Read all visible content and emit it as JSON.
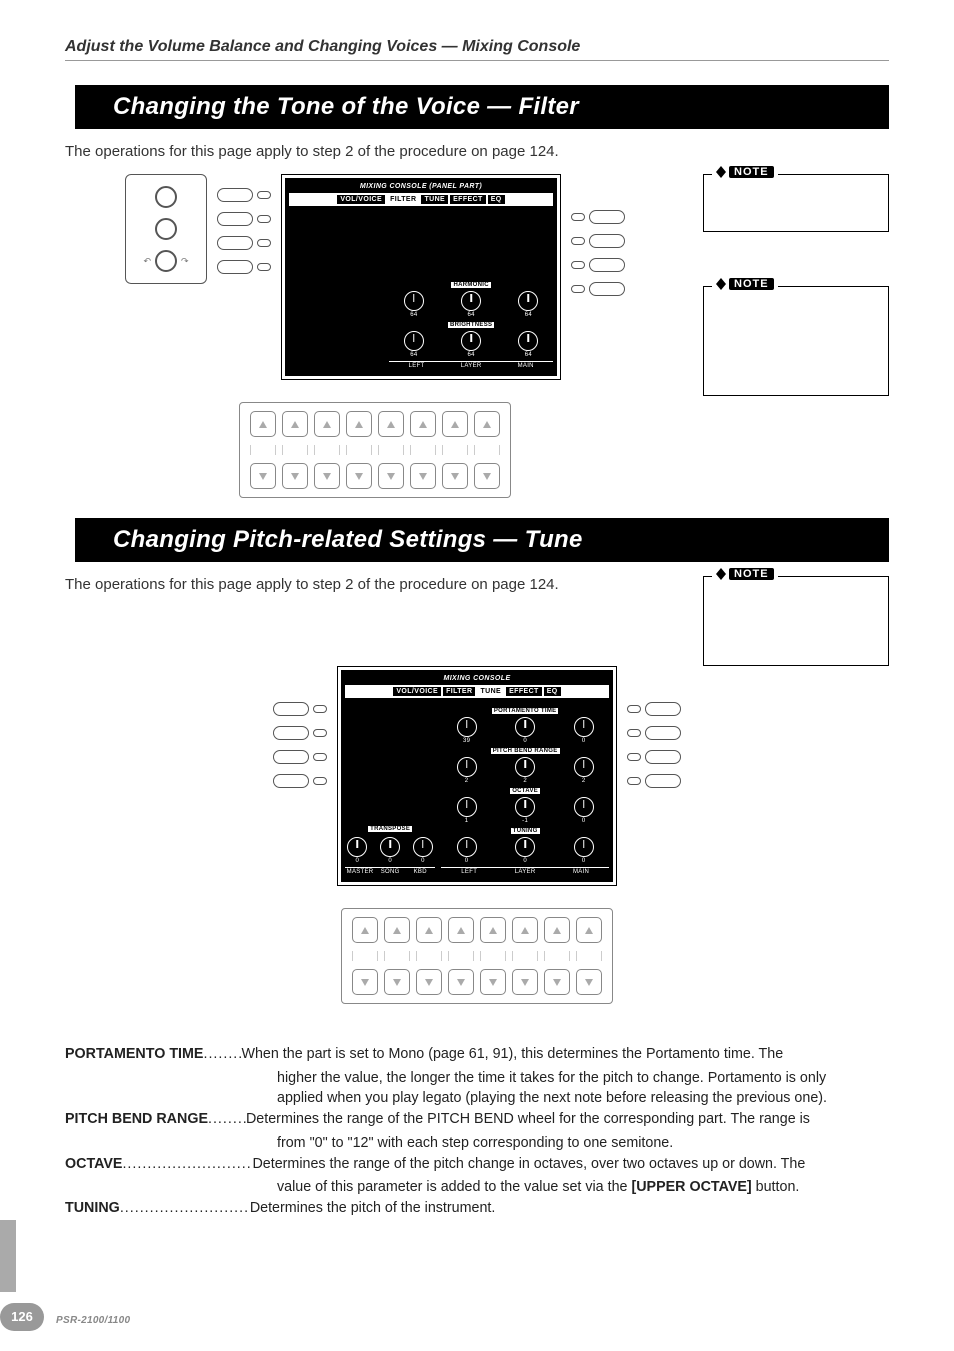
{
  "header": "Adjust the Volume Balance and Changing Voices — Mixing Console",
  "sectionA": {
    "title": "Changing the Tone of the Voice — Filter",
    "intro": "The operations for this page apply to step 2 of the procedure on page 124.",
    "screen": {
      "title": "MIXING CONSOLE (PANEL PART)",
      "tabs": [
        "VOL/VOICE",
        "FILTER",
        "TUNE",
        "EFFECT",
        "EQ"
      ],
      "active_tab": "FILTER",
      "sections": [
        {
          "name": "HARMONIC",
          "cols": [
            {
              "col": "LEFT",
              "value": "64"
            },
            {
              "col": "LAYER",
              "value": "64"
            },
            {
              "col": "MAIN",
              "value": "64"
            }
          ]
        },
        {
          "name": "BRIGHTNESS",
          "cols": [
            {
              "col": "LEFT",
              "value": "64"
            },
            {
              "col": "LAYER",
              "value": "64"
            },
            {
              "col": "MAIN",
              "value": "64"
            }
          ]
        }
      ],
      "col_labels": [
        "LEFT",
        "LAYER",
        "MAIN"
      ]
    },
    "note1_label": "NOTE",
    "note2_label": "NOTE",
    "under_button_count": 8
  },
  "sectionB": {
    "title": "Changing Pitch-related Settings — Tune",
    "intro": "The operations for this page apply to step 2 of the procedure on page 124.",
    "note_label": "NOTE",
    "screen": {
      "title": "MIXING CONSOLE",
      "tabs": [
        "VOL/VOICE",
        "FILTER",
        "TUNE",
        "EFFECT",
        "EQ"
      ],
      "active_tab": "TUNE",
      "right_sections": [
        {
          "name": "PORTAMENTO TIME",
          "vals": [
            "39",
            "0",
            "0"
          ]
        },
        {
          "name": "PITCH BEND RANGE",
          "vals": [
            "2",
            "2",
            "2"
          ]
        },
        {
          "name": "OCTAVE",
          "vals": [
            "1",
            "-1",
            "0"
          ]
        },
        {
          "name": "TUNING",
          "vals": [
            "0",
            "0",
            "0"
          ]
        }
      ],
      "right_col_labels": [
        "LEFT",
        "LAYER",
        "MAIN"
      ],
      "left_section": {
        "name": "TRANSPOSE",
        "vals": [
          "0",
          "0",
          "0"
        ],
        "col_labels": [
          "MASTER",
          "SONG",
          "KBD"
        ]
      }
    },
    "under_button_count": 8
  },
  "defs": {
    "portamento_label": "PORTAMENTO TIME",
    "portamento_text_l1": "When the part is set to Mono (page 61, 91), this determines the Portamento time. The",
    "portamento_text_l2": "higher the value, the longer the time it takes for the pitch to change. Portamento is only",
    "portamento_text_l3": "applied when you play legato (playing the next note before releasing the previous one).",
    "pitchbend_label": "PITCH BEND RANGE",
    "pitchbend_text_l1": "Determines the range of the PITCH BEND wheel for the corresponding part. The range is",
    "pitchbend_text_l2": "from \"0\" to \"12\" with each step corresponding to one semitone.",
    "octave_label": "OCTAVE",
    "octave_text_l1": "Determines the range of the pitch change in octaves, over two octaves up or down. The",
    "octave_text_l2_a": "value of this parameter is added to the value set via the ",
    "octave_text_l2_b": "[UPPER OCTAVE]",
    "octave_text_l2_c": " button.",
    "tuning_label": "TUNING",
    "tuning_text": "Determines the pitch of the instrument."
  },
  "footer": {
    "page": "126",
    "model": "PSR-2100/1100"
  }
}
